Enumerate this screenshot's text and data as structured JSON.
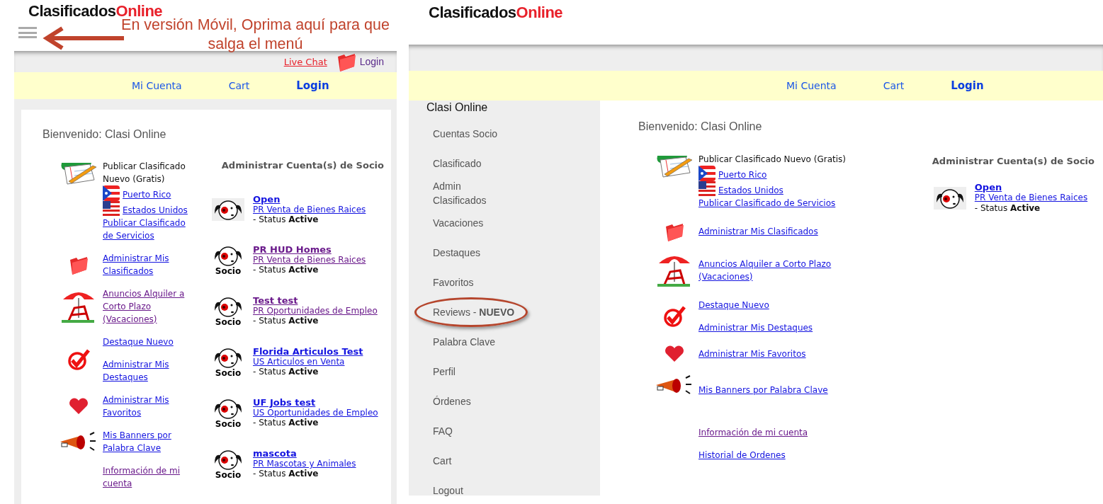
{
  "mobile_view": {
    "logo": {
      "dark": "Clasificados",
      "accent": "Online"
    },
    "annotation": "En versión Móvil, Oprima aquí para que salga el menú",
    "top_bar": {
      "chat_link": "Live Chat",
      "login_link": "Login"
    },
    "nav": [
      {
        "label": "Mi Cuenta",
        "selected": false
      },
      {
        "label": "Cart",
        "selected": false
      },
      {
        "label": "Login",
        "selected": true
      }
    ],
    "welcome": "Bienvenido: Clasi Online",
    "actions": [
      {
        "kind": "publish",
        "text": "Publicar Clasificado Nuevo (Gratis)",
        "flags": [
          {
            "kind": "pr",
            "label": "Puerto Rico",
            "visited": false
          },
          {
            "kind": "us",
            "label": "Estados Unidos",
            "visited": false
          }
        ],
        "links": [
          {
            "label": "Publicar Clasificado de Servicios",
            "visited": false
          }
        ]
      },
      {
        "kind": "folder",
        "links": [
          {
            "label": "Administrar Mis Clasificados",
            "visited": false
          }
        ]
      },
      {
        "kind": "vacation",
        "links": [
          {
            "label": "Anuncios Alquiler a Corto Plazo (Vacaciones)",
            "visited": true
          }
        ]
      },
      {
        "kind": "highlight",
        "links": [
          {
            "label": "Destaque Nuevo",
            "visited": false
          },
          {
            "label": "Administrar Mis Destaques",
            "visited": false
          }
        ]
      },
      {
        "kind": "favorite",
        "links": [
          {
            "label": "Administrar Mis Favoritos",
            "visited": false
          }
        ]
      },
      {
        "kind": "banner",
        "links": [
          {
            "label": "Mis Banners por Palabra Clave",
            "visited": false
          }
        ]
      },
      {
        "kind": "info",
        "links": [
          {
            "label": "Información de mi cuenta",
            "visited": true
          }
        ]
      }
    ],
    "accounts_heading": "Administrar Cuenta(s) de Socio",
    "accounts": [
      {
        "kind": "plain",
        "name": "Open",
        "category": "PR Venta de Bienes Raices",
        "status": "- Status **Active**",
        "visited": false
      },
      {
        "kind": "socio",
        "badge": "Socio",
        "name": "PR HUD Homes",
        "category": "PR Venta de Bienes Raices",
        "status": "- Status **Active**",
        "visited": true
      },
      {
        "kind": "socio",
        "badge": "Socio",
        "name": "Test test",
        "category": "PR Oportunidades de Empleo",
        "status": "- Status **Active**",
        "visited": true
      },
      {
        "kind": "socio",
        "badge": "Socio",
        "name": "Florida Articulos Test",
        "category": "US Articulos en Venta",
        "status": "- Status **Active**",
        "visited": false
      },
      {
        "kind": "socio",
        "badge": "Socio",
        "name": "UF Jobs test",
        "category": "US Oportunidades de Empleo",
        "status": "- Status **Active**",
        "visited": false
      },
      {
        "kind": "socio",
        "badge": "Socio",
        "name": "mascota",
        "category": "PR Mascotas y Animales",
        "status": "- Status **Active**",
        "visited": false
      }
    ]
  },
  "desktop_view": {
    "logo": {
      "dark": "Clasificados",
      "accent": "Online"
    },
    "nav": [
      {
        "label": "Mi Cuenta",
        "selected": false
      },
      {
        "label": "Cart",
        "selected": false
      },
      {
        "label": "Login",
        "selected": true
      }
    ],
    "sidebar": {
      "title": "Clasi Online",
      "items": [
        {
          "label": "Cuentas Socio",
          "wrapped": false,
          "circled": false
        },
        {
          "label": "Clasificado",
          "wrapped": false,
          "circled": false
        },
        {
          "label": "Admin Clasificados",
          "wrapped": true,
          "circled": false
        },
        {
          "label": "Vacaciones",
          "wrapped": false,
          "circled": false
        },
        {
          "label": "Destaques",
          "wrapped": false,
          "circled": false
        },
        {
          "label": "Favoritos",
          "wrapped": false,
          "circled": false
        },
        {
          "label": "Reviews - **NUEVO**",
          "wrapped": false,
          "circled": true
        },
        {
          "label": "Palabra Clave",
          "wrapped": false,
          "circled": false
        },
        {
          "label": "Perfil",
          "wrapped": false,
          "circled": false
        },
        {
          "label": "Órdenes",
          "wrapped": false,
          "circled": false
        },
        {
          "label": "FAQ",
          "wrapped": false,
          "circled": false
        },
        {
          "label": "Cart",
          "wrapped": false,
          "circled": false
        },
        {
          "label": "Logout",
          "wrapped": false,
          "circled": false
        }
      ]
    },
    "welcome": "Bienvenido: Clasi Online",
    "actions": [
      {
        "kind": "publish",
        "text": "Publicar Clasificado Nuevo (Gratis)",
        "flags": [
          {
            "kind": "pr",
            "label": "Puerto Rico",
            "visited": false
          },
          {
            "kind": "us",
            "label": "Estados Unidos",
            "visited": false
          }
        ],
        "links": [
          {
            "label": "Publicar Clasificado de Servicios",
            "visited": false
          }
        ]
      },
      {
        "kind": "folder",
        "links": [
          {
            "label": "Administrar Mis Clasificados",
            "visited": false
          }
        ]
      },
      {
        "kind": "vacation",
        "links": [
          {
            "label": "Anuncios Alquiler a Corto Plazo (Vacaciones)",
            "visited": false
          }
        ]
      },
      {
        "kind": "highlight",
        "links": [
          {
            "label": "Destaque Nuevo",
            "visited": false
          },
          {
            "label": "Administrar Mis Destaques",
            "visited": false
          }
        ]
      },
      {
        "kind": "favorite",
        "links": [
          {
            "label": "Administrar Mis Favoritos",
            "visited": false
          }
        ]
      },
      {
        "kind": "banner",
        "links": [
          {
            "label": "Mis Banners por Palabra Clave",
            "visited": false
          }
        ]
      },
      {
        "kind": "info",
        "links": [
          {
            "label": "Información de mi cuenta",
            "visited": true
          },
          {
            "label": "Historial de Ordenes",
            "visited": false
          }
        ]
      }
    ],
    "accounts_heading": "Administrar Cuenta(s) de Socio",
    "accounts": [
      {
        "kind": "plain",
        "name": "Open",
        "category": "PR Venta de Bienes Raices",
        "status": "- Status **Active**",
        "visited": false
      }
    ]
  }
}
